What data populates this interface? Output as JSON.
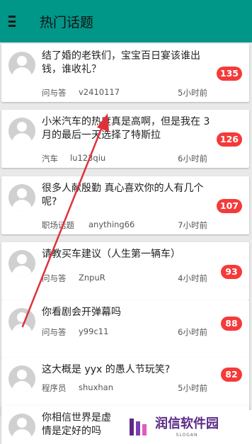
{
  "header": {
    "title": "热门话题",
    "menu_icon": "hamburger-menu-icon",
    "color": "#009688"
  },
  "posts": [
    {
      "title": "结了婚的老铁们，宝宝百日宴该谁出钱，谁收礼？",
      "category": "问与答",
      "user": "v2410117",
      "time": "5小时前",
      "count": "135"
    },
    {
      "title": "小米汽车的热度真是高啊，但是我在 3 月的最后一天选择了特斯拉",
      "category": "汽车",
      "user": "lu123qiu",
      "time": "6小时前",
      "count": "126"
    },
    {
      "title": "很多人献殷勤 真心喜欢你的人有几个呢?",
      "category": "职场话题",
      "user": "anything66",
      "time": "7小时前",
      "count": "107"
    },
    {
      "title": "请教买车建议（人生第一辆车）",
      "category": "问与答",
      "user": "ZnpuR",
      "time": "4小时前",
      "count": "93"
    },
    {
      "title": "你看剧会开弹幕吗",
      "category": "问与答",
      "user": "y99c11",
      "time": "6小时前",
      "count": "88"
    },
    {
      "title": "这大概是 yyx 的愚人节玩笑?",
      "category": "程序员",
      "user": "shuxhan",
      "time": "5小时前",
      "count": "82"
    },
    {
      "title": "你相信世界是虚情是定好的吗",
      "category": "",
      "user": "",
      "time": "",
      "count": ""
    }
  ],
  "badge_color": "#f53a3a",
  "annotation": {
    "color": "#e0313a",
    "shape": "arrow"
  },
  "watermark": {
    "name": "润信软件园",
    "slogan": "SLOGAN"
  }
}
